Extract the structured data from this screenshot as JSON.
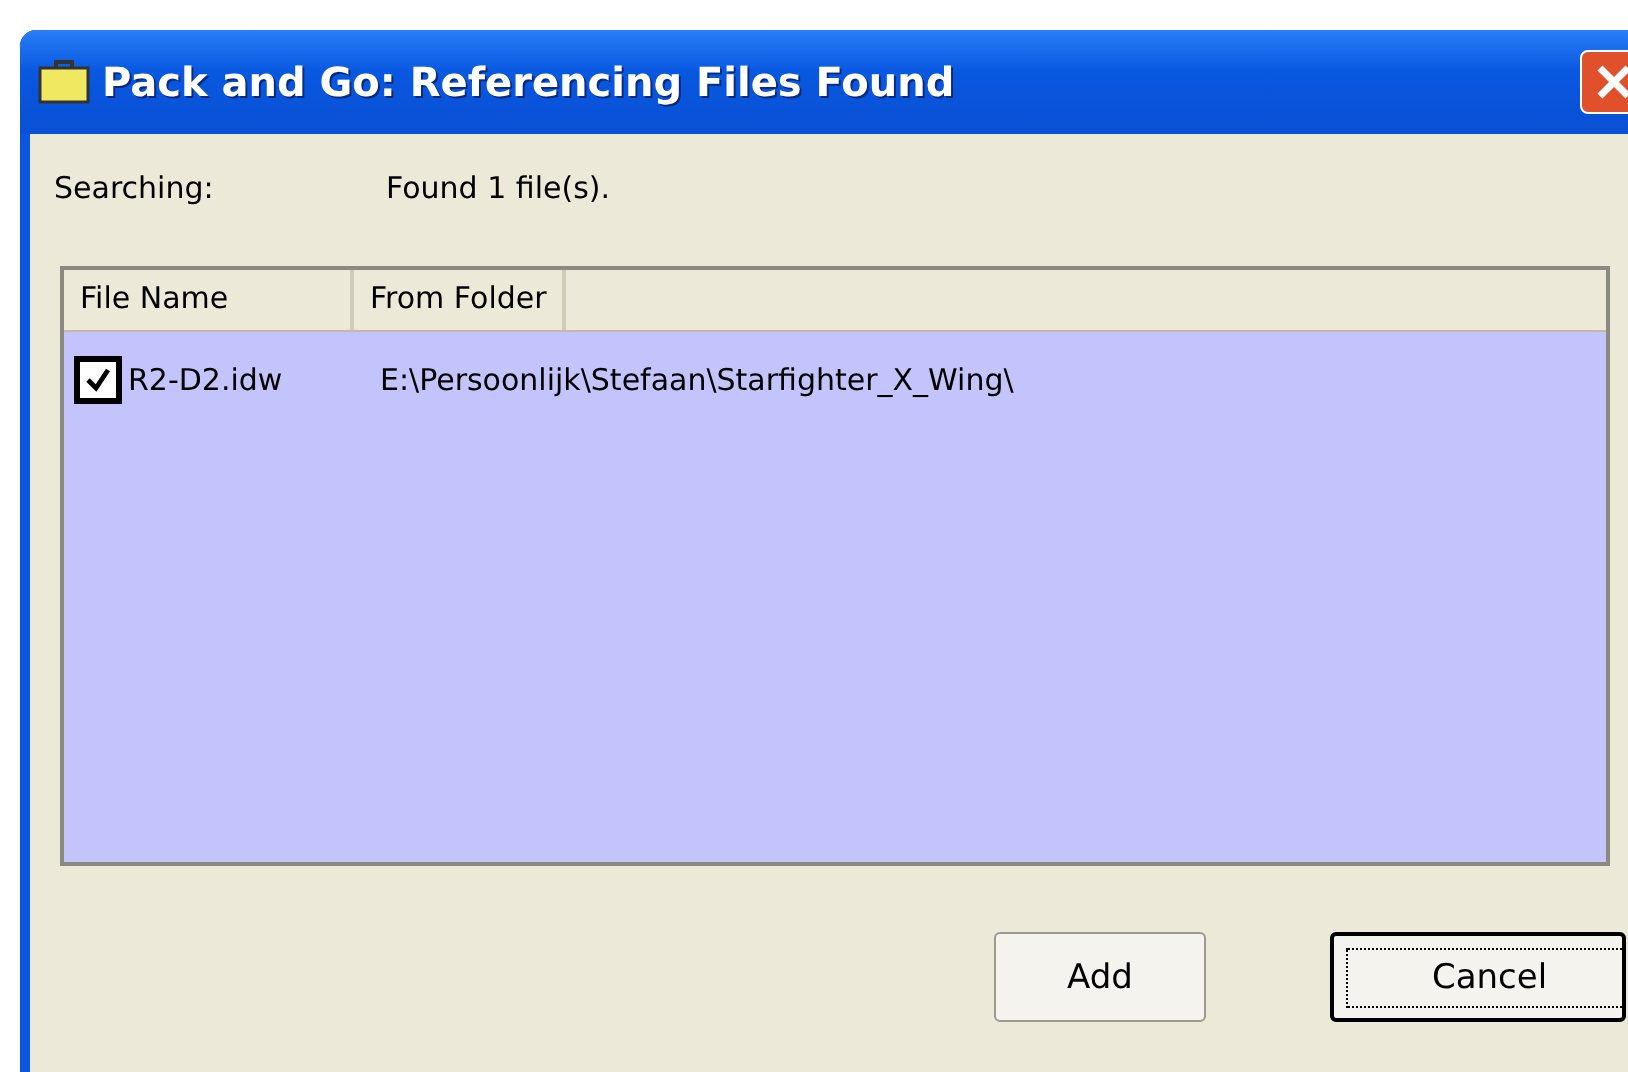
{
  "window": {
    "title": "Pack and Go: Referencing Files Found"
  },
  "status": {
    "label": "Searching:",
    "value": "Found 1 file(s)."
  },
  "table": {
    "columns": [
      "File Name",
      "From Folder"
    ],
    "rows": [
      {
        "file_name": "R2-D2.idw",
        "from_folder": "E:\\Persoonlijk\\Stefaan\\Starfighter_X_Wing\\",
        "checked": true
      }
    ]
  },
  "buttons": [
    {
      "label": "Add",
      "default": false
    },
    {
      "label": "Cancel",
      "default": true
    }
  ]
}
